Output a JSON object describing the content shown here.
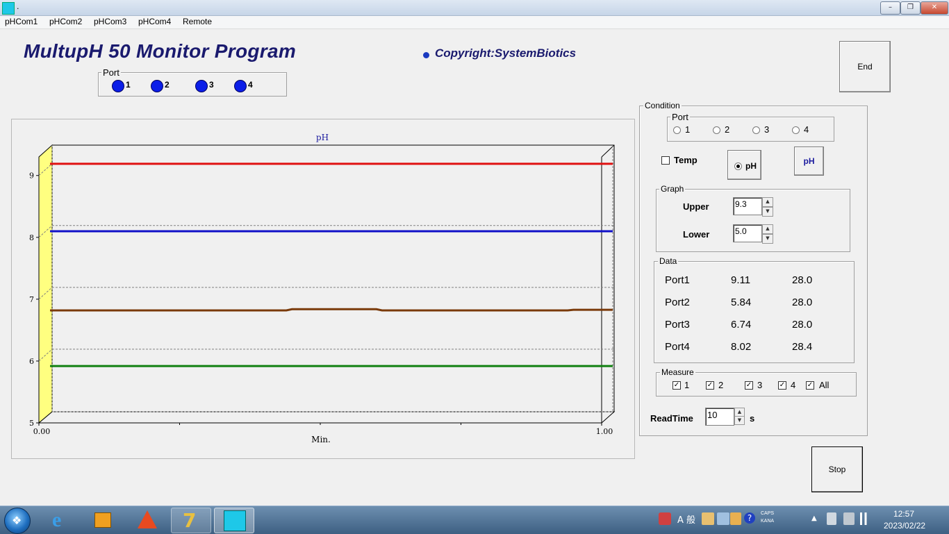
{
  "window": {
    "title": "."
  },
  "menu": [
    "pHCom1",
    "pHCom2",
    "pHCom3",
    "pHCom4",
    "Remote"
  ],
  "header": {
    "title": "MultupH 50 Monitor Program",
    "copyright": "Copyright:SystemBiotics"
  },
  "port_indicator": {
    "label": "Port",
    "ports": [
      "1",
      "2",
      "3",
      "4"
    ],
    "led_color": "#0b1ee8"
  },
  "buttons": {
    "end": "End",
    "stop": "Stop",
    "ph": "pH"
  },
  "chart_data": {
    "type": "line",
    "title": "pH",
    "xlabel": "Min.",
    "ylabel": "",
    "xlim": [
      0.0,
      1.0
    ],
    "ylim": [
      5,
      9.3
    ],
    "x_ticks": [
      "0.00",
      "1.00"
    ],
    "y_ticks": [
      "5",
      "6",
      "7",
      "8",
      "9"
    ],
    "grid": true,
    "series": [
      {
        "color": "#e01010",
        "x": [
          0.0,
          1.0
        ],
        "y": [
          9.11,
          9.11
        ]
      },
      {
        "color": "#1010c8",
        "x": [
          0.0,
          1.0
        ],
        "y": [
          8.02,
          8.02
        ]
      },
      {
        "color": "#7a3a0a",
        "x": [
          0.0,
          0.42,
          0.43,
          0.58,
          0.59,
          0.92,
          0.93,
          1.0
        ],
        "y": [
          6.74,
          6.74,
          6.76,
          6.76,
          6.74,
          6.74,
          6.75,
          6.75
        ]
      },
      {
        "color": "#108010",
        "x": [
          0.0,
          1.0
        ],
        "y": [
          5.84,
          5.84
        ]
      }
    ]
  },
  "condition": {
    "label": "Condition",
    "port": {
      "label": "Port",
      "options": [
        "1",
        "2",
        "3",
        "4"
      ]
    },
    "temp_label": "Temp",
    "ph_radio_label": "pH",
    "graph": {
      "label": "Graph",
      "upper_label": "Upper",
      "upper_value": "9.3",
      "lower_label": "Lower",
      "lower_value": "5.0"
    },
    "data": {
      "label": "Data",
      "rows": [
        {
          "port": "Port1",
          "ph": "9.11",
          "temp": "28.0"
        },
        {
          "port": "Port2",
          "ph": "5.84",
          "temp": "28.0"
        },
        {
          "port": "Port3",
          "ph": "6.74",
          "temp": "28.0"
        },
        {
          "port": "Port4",
          "ph": "8.02",
          "temp": "28.4"
        }
      ]
    },
    "measure": {
      "label": "Measure",
      "items": [
        "1",
        "2",
        "3",
        "4",
        "All"
      ]
    },
    "readtime": {
      "label": "ReadTime",
      "value": "10",
      "unit": "s"
    }
  },
  "taskbar": {
    "ime_label": "A 般",
    "caps": "CAPS",
    "kana": "KANA",
    "time": "12:57",
    "date": "2023/02/22"
  }
}
